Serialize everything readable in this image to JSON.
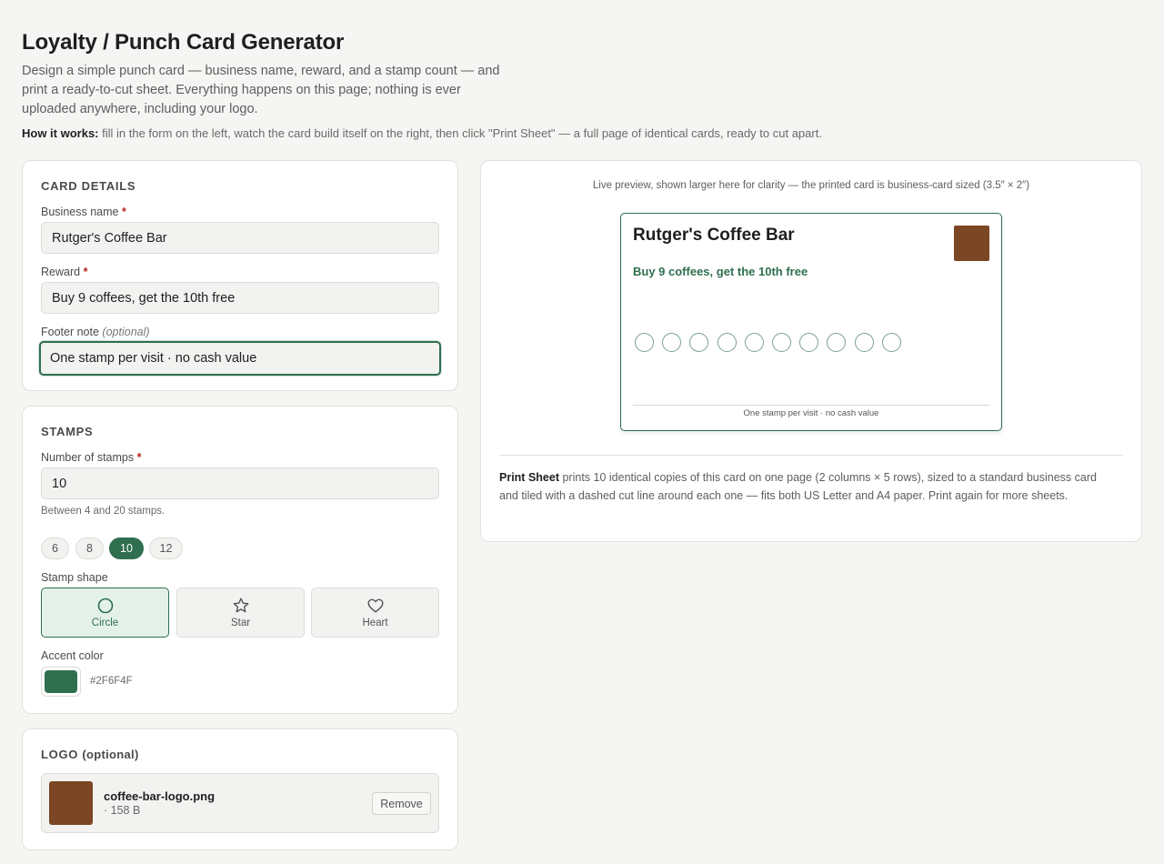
{
  "header": {
    "title": "Loyalty / Punch Card Generator",
    "intro": "Design a simple punch card — business name, reward, and a stamp count — and print a ready-to-cut sheet. Everything happens on this page; nothing is ever uploaded anywhere, including your logo.",
    "how_label": "How it works:",
    "how_text": " fill in the form on the left, watch the card build itself on the right, then click \"Print Sheet\" — a full page of identical cards, ready to cut apart."
  },
  "card_details": {
    "title": "CARD DETAILS",
    "business_label": "Business name",
    "business_value": "Rutger's Coffee Bar",
    "reward_label": "Reward",
    "reward_value": "Buy 9 coffees, get the 10th free",
    "footer_label": "Footer note",
    "footer_optional": "(optional)",
    "footer_value": "One stamp per visit · no cash value",
    "required_mark": "*"
  },
  "stamps": {
    "title": "STAMPS",
    "count_label": "Number of stamps",
    "count_value": "10",
    "count_hint": "Between 4 and 20 stamps.",
    "presets": [
      "6",
      "8",
      "10",
      "12"
    ],
    "active_preset": "10",
    "shape_label": "Stamp shape",
    "shapes": [
      {
        "label": "Circle",
        "icon": "circle-icon",
        "active": true
      },
      {
        "label": "Star",
        "icon": "star-icon",
        "active": false
      },
      {
        "label": "Heart",
        "icon": "heart-icon",
        "active": false
      }
    ],
    "accent_label": "Accent color",
    "accent_value": "#2F6F4F"
  },
  "logo": {
    "title": "LOGO",
    "title_tail": "(optional)",
    "file_name": "coffee-bar-logo.png",
    "file_size": "· 158 B",
    "remove_label": "Remove",
    "logo_color": "#7a4623"
  },
  "preview": {
    "caption": "Live preview, shown larger here for clarity — the printed card is business-card sized (3.5″ × 2″)",
    "card_business": "Rutger's Coffee Bar",
    "card_reward": "Buy 9 coffees, get the 10th free",
    "stamp_count": 10,
    "card_footer": "One stamp per visit · no cash value",
    "print_label": "Print Sheet",
    "print_text": " prints 10 identical copies of this card on one page (2 columns × 5 rows), sized to a standard business card and tiled with a dashed cut line around each one — fits both US Letter and A4 paper. Print again for more sheets."
  }
}
